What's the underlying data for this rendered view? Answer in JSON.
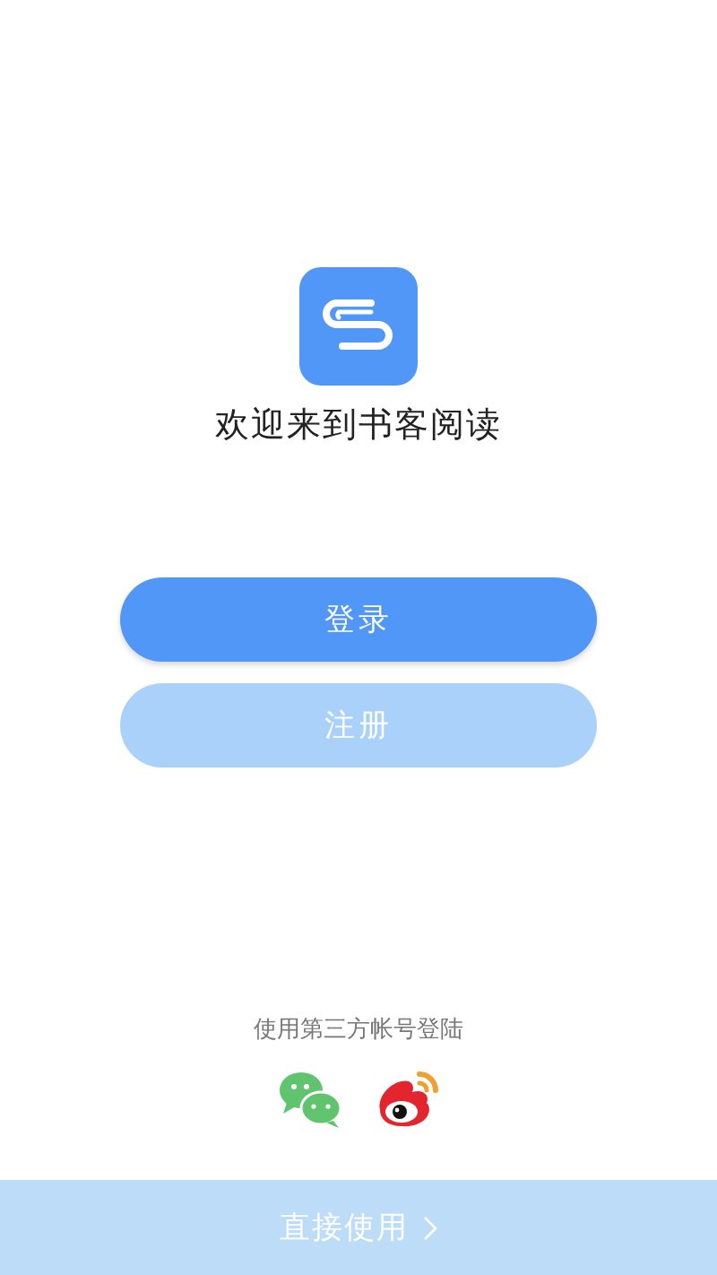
{
  "welcome": {
    "title": "欢迎来到书客阅读"
  },
  "buttons": [
    {
      "label": "登录",
      "kind": "primary"
    },
    {
      "label": "注册",
      "kind": "secondary"
    }
  ],
  "third_party": {
    "label": "使用第三方帐号登陆"
  },
  "direct_use": {
    "label": "直接使用"
  }
}
